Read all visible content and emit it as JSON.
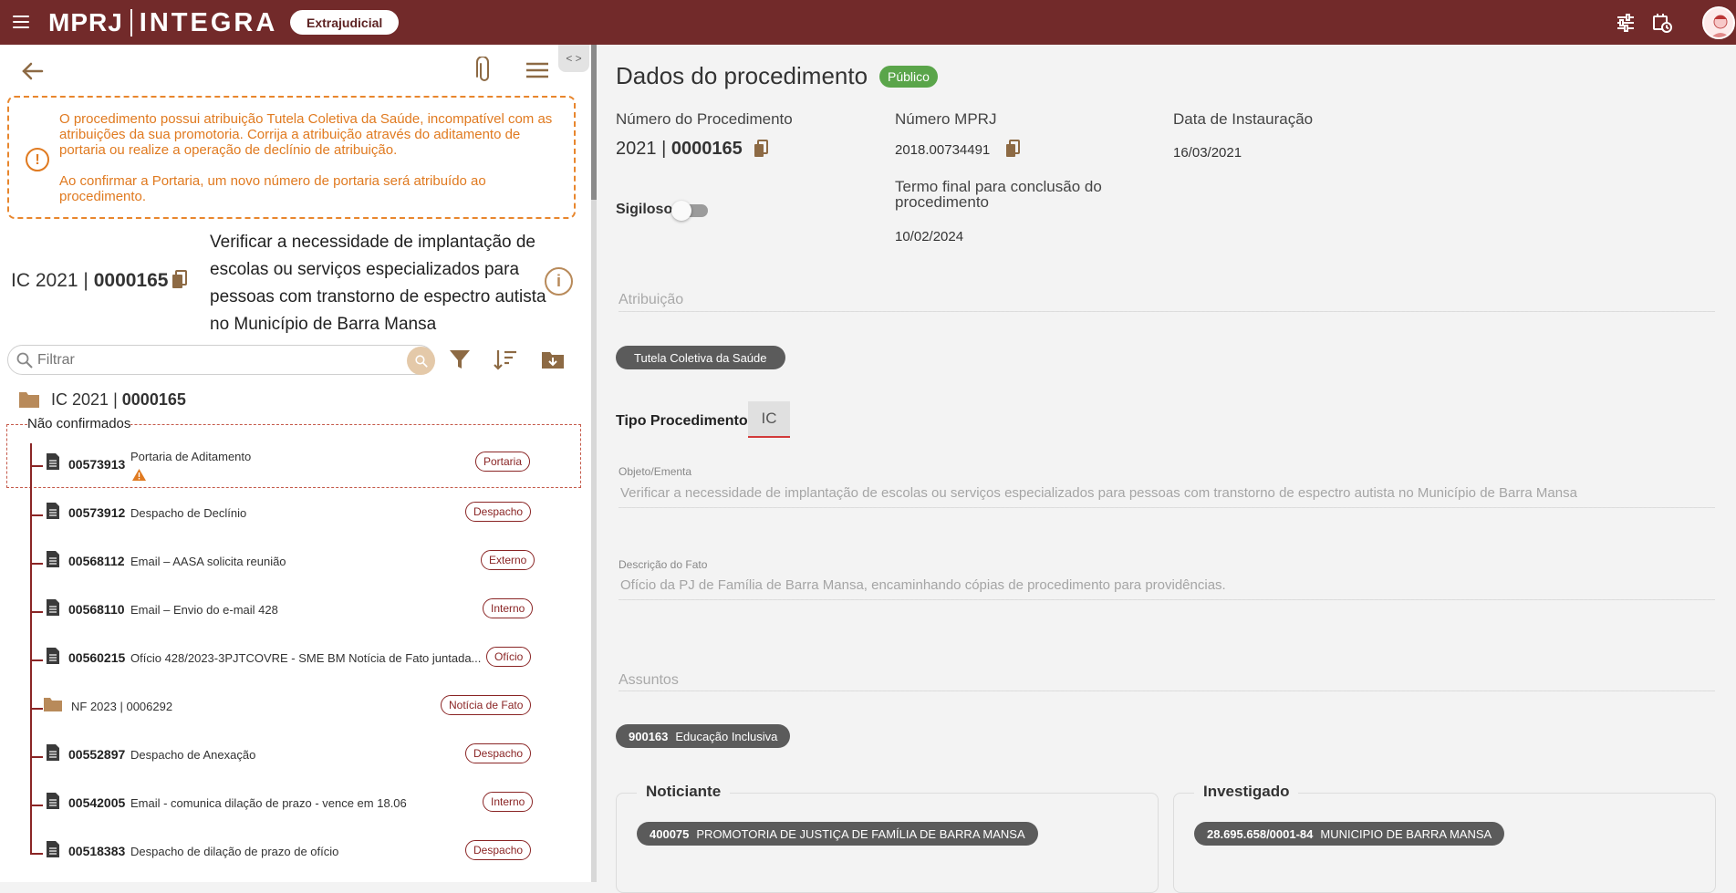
{
  "topbar": {
    "logo_left": "MPRJ",
    "logo_right": "INTEGRA",
    "context_pill": "Extrajudicial"
  },
  "left": {
    "toggle_tab": "< >",
    "warning": {
      "line1": "O procedimento possui atribuição Tutela Coletiva da Saúde, incompatível com as atribuições da sua promotoria. Corrija a atribuição através do aditamento de portaria ou realize a operação de declínio de atribuição.",
      "line2": "Ao confirmar a Portaria, um novo número de portaria será atribuído ao procedimento."
    },
    "procedure": {
      "type": "IC",
      "year": "2021",
      "sep": "|",
      "number": "0000165",
      "title": "Verificar a necessidade de implantação de escolas ou serviços especializados para pessoas com transtorno de espectro autista no Município de Barra Mansa"
    },
    "filter": {
      "placeholder": "Filtrar"
    },
    "tree_root": {
      "type": "IC",
      "year": "2021",
      "sep": "|",
      "number": "0000165"
    },
    "group_label": "Não confirmados",
    "docs": [
      {
        "id": "00573913",
        "title": "Portaria de Aditamento",
        "tag": "Portaria"
      },
      {
        "id": "00573912",
        "title": "Despacho de Declínio",
        "tag": "Despacho"
      },
      {
        "id": "00568112",
        "title": "Email – AASA solicita reunião",
        "tag": "Externo"
      },
      {
        "id": "00568110",
        "title": "Email – Envio do e-mail 428",
        "tag": "Interno"
      },
      {
        "id": "00560215",
        "title": "Ofício 428/2023-3PJTCOVRE - SME BM Notícia de Fato juntada...",
        "tag": "Ofício"
      },
      {
        "id": "",
        "title": "NF 2023 | 0006292",
        "tag": "Notícia de Fato"
      },
      {
        "id": "00552897",
        "title": "Despacho de Anexação",
        "tag": "Despacho"
      },
      {
        "id": "00542005",
        "title": "Email - comunica dilação de prazo - vence em 18.06",
        "tag": "Interno"
      },
      {
        "id": "00518383",
        "title": "Despacho de dilação de prazo de ofício",
        "tag": "Despacho"
      }
    ]
  },
  "right": {
    "title": "Dados do procedimento",
    "badge": "Público",
    "numero_proc_label": "Número do Procedimento",
    "numero_proc_year": "2021",
    "numero_proc_sep": "|",
    "numero_proc_num": "0000165",
    "numero_mprj_label": "Número MPRJ",
    "numero_mprj": "2018.00734491",
    "data_inst_label": "Data de Instauração",
    "data_inst": "16/03/2021",
    "sigiloso_label": "Sigiloso",
    "termo_label": "Termo final para conclusão do procedimento",
    "termo": "10/02/2024",
    "atribuicao_label": "Atribuição",
    "atribuicao_chip": "Tutela Coletiva da Saúde",
    "tipo_label": "Tipo Procedimento *",
    "tipo_value": "IC",
    "objeto_label": "Objeto/Ementa",
    "objeto": "Verificar a necessidade de implantação de escolas ou serviços especializados para pessoas com transtorno de espectro autista no Município de Barra Mansa",
    "descricao_label": "Descrição do Fato",
    "descricao": "Ofício da PJ de Família de Barra Mansa, encaminhando cópias de procedimento para providências.",
    "assuntos_label": "Assuntos",
    "assunto_code": "900163",
    "assunto_name": "Educação Inclusiva",
    "noticiante_title": "Noticiante",
    "noticiante_code": "400075",
    "noticiante_name": "PROMOTORIA DE JUSTIÇA DE FAMÍLIA DE BARRA MANSA",
    "investigado_title": "Investigado",
    "investigado_code": "28.695.658/0001-84",
    "investigado_name": "MUNICIPIO DE BARRA MANSA"
  },
  "colors": {
    "topbar": "#722a2a",
    "accent_brown": "#b88a5a",
    "warning_orange": "#e07a20",
    "public_green": "#5aa54a",
    "tag_red": "#8a2525"
  }
}
